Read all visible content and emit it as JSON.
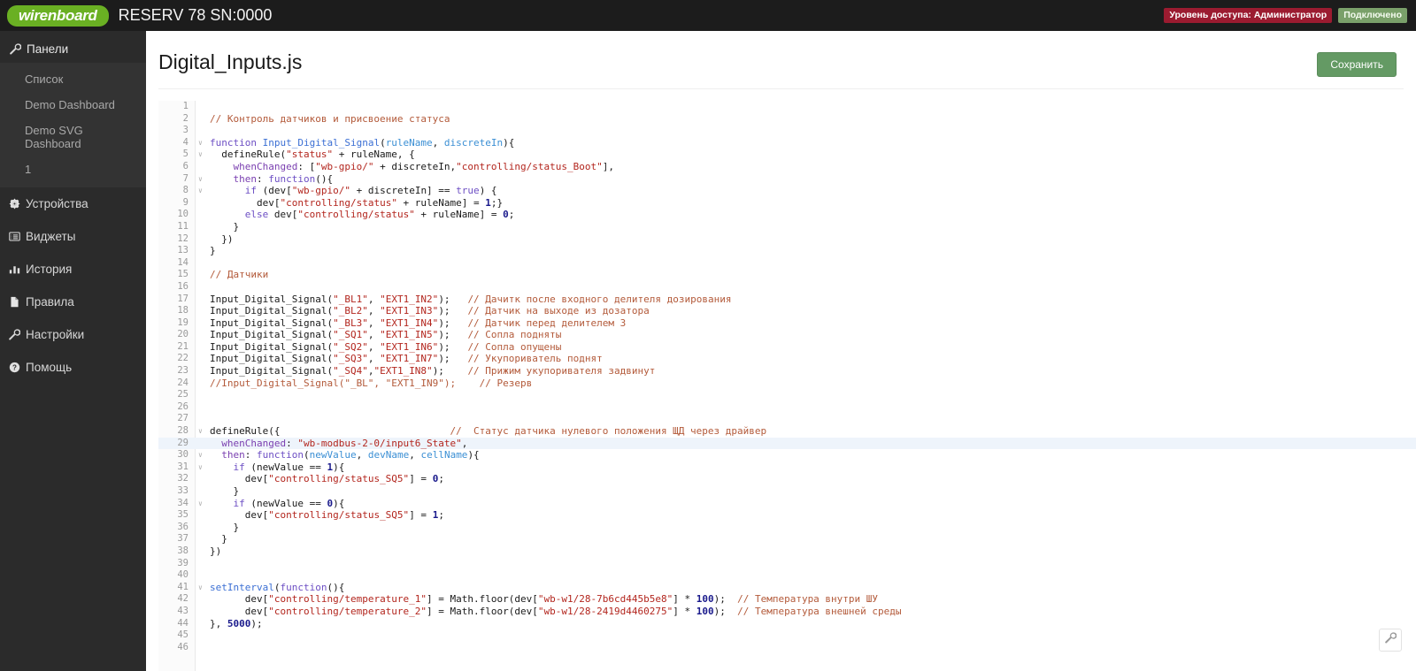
{
  "topbar": {
    "brand": "wirenboard",
    "device_title": "RESERV 78 SN:0000",
    "badge_access": "Уровень доступа: Администратор",
    "badge_connection": "Подключено",
    "brand_color": "#6ab023",
    "access_color": "#9b1b30",
    "connection_color": "#7aa06a"
  },
  "sidebar": {
    "panels_label": "Панели",
    "sub_items": [
      {
        "label": "Список"
      },
      {
        "label": "Demo Dashboard"
      },
      {
        "label": "Demo SVG Dashboard"
      },
      {
        "label": "1"
      }
    ],
    "items": [
      {
        "label": "Устройства",
        "icon": "gear-icon"
      },
      {
        "label": "Виджеты",
        "icon": "list-alt-icon"
      },
      {
        "label": "История",
        "icon": "bar-chart-icon"
      },
      {
        "label": "Правила",
        "icon": "file-icon"
      },
      {
        "label": "Настройки",
        "icon": "wrench-icon"
      },
      {
        "label": "Помощь",
        "icon": "question-circle-icon"
      }
    ]
  },
  "page": {
    "title": "Digital_Inputs.js",
    "save_label": "Сохранить",
    "float_button_icon": "wrench-icon"
  },
  "editor": {
    "active_line": 29,
    "total_lines": 46,
    "lines": [
      {
        "n": 1,
        "fold": false,
        "tokens": []
      },
      {
        "n": 2,
        "fold": false,
        "tokens": [
          {
            "c": "com",
            "t": "// Контроль датчиков и присвоение статуса"
          }
        ]
      },
      {
        "n": 3,
        "fold": false,
        "tokens": []
      },
      {
        "n": 4,
        "fold": true,
        "tokens": [
          {
            "c": "kw",
            "t": "function "
          },
          {
            "c": "fn",
            "t": "Input_Digital_Signal"
          },
          {
            "c": "pln",
            "t": "("
          },
          {
            "c": "var",
            "t": "ruleName"
          },
          {
            "c": "pln",
            "t": ", "
          },
          {
            "c": "var",
            "t": "discreteIn"
          },
          {
            "c": "pln",
            "t": "){"
          }
        ]
      },
      {
        "n": 5,
        "fold": true,
        "tokens": [
          {
            "c": "pln",
            "t": "  defineRule("
          },
          {
            "c": "str",
            "t": "\"status\""
          },
          {
            "c": "pln",
            "t": " + ruleName, {"
          }
        ]
      },
      {
        "n": 6,
        "fold": false,
        "tokens": [
          {
            "c": "prop",
            "t": "    whenChanged"
          },
          {
            "c": "pln",
            "t": ": ["
          },
          {
            "c": "str",
            "t": "\"wb-gpio/\""
          },
          {
            "c": "pln",
            "t": " + discreteIn,"
          },
          {
            "c": "str",
            "t": "\"controlling/status_Boot\""
          },
          {
            "c": "pln",
            "t": "],"
          }
        ]
      },
      {
        "n": 7,
        "fold": true,
        "tokens": [
          {
            "c": "prop",
            "t": "    then"
          },
          {
            "c": "pln",
            "t": ": "
          },
          {
            "c": "kw",
            "t": "function"
          },
          {
            "c": "pln",
            "t": "(){"
          }
        ]
      },
      {
        "n": 8,
        "fold": true,
        "tokens": [
          {
            "c": "kw",
            "t": "      if "
          },
          {
            "c": "pln",
            "t": "(dev["
          },
          {
            "c": "str",
            "t": "\"wb-gpio/\""
          },
          {
            "c": "pln",
            "t": " + discreteIn] == "
          },
          {
            "c": "bool",
            "t": "true"
          },
          {
            "c": "pln",
            "t": ") {"
          }
        ]
      },
      {
        "n": 9,
        "fold": false,
        "tokens": [
          {
            "c": "pln",
            "t": "        dev["
          },
          {
            "c": "str",
            "t": "\"controlling/status\""
          },
          {
            "c": "pln",
            "t": " + ruleName] = "
          },
          {
            "c": "num",
            "t": "1"
          },
          {
            "c": "pln",
            "t": ";}"
          }
        ]
      },
      {
        "n": 10,
        "fold": false,
        "tokens": [
          {
            "c": "kw",
            "t": "      else "
          },
          {
            "c": "pln",
            "t": "dev["
          },
          {
            "c": "str",
            "t": "\"controlling/status\""
          },
          {
            "c": "pln",
            "t": " + ruleName] = "
          },
          {
            "c": "num",
            "t": "0"
          },
          {
            "c": "pln",
            "t": ";"
          }
        ]
      },
      {
        "n": 11,
        "fold": false,
        "tokens": [
          {
            "c": "pln",
            "t": "    }"
          }
        ]
      },
      {
        "n": 12,
        "fold": false,
        "tokens": [
          {
            "c": "pln",
            "t": "  })"
          }
        ]
      },
      {
        "n": 13,
        "fold": false,
        "tokens": [
          {
            "c": "pln",
            "t": "}"
          }
        ]
      },
      {
        "n": 14,
        "fold": false,
        "tokens": []
      },
      {
        "n": 15,
        "fold": false,
        "tokens": [
          {
            "c": "com",
            "t": "// Датчики"
          }
        ]
      },
      {
        "n": 16,
        "fold": false,
        "tokens": []
      },
      {
        "n": 17,
        "fold": false,
        "tokens": [
          {
            "c": "pln",
            "t": "Input_Digital_Signal("
          },
          {
            "c": "str",
            "t": "\"_BL1\""
          },
          {
            "c": "pln",
            "t": ", "
          },
          {
            "c": "str",
            "t": "\"EXT1_IN2\""
          },
          {
            "c": "pln",
            "t": ");   "
          },
          {
            "c": "com",
            "t": "// Дачитк после входного делителя дозирования"
          }
        ]
      },
      {
        "n": 18,
        "fold": false,
        "tokens": [
          {
            "c": "pln",
            "t": "Input_Digital_Signal("
          },
          {
            "c": "str",
            "t": "\"_BL2\""
          },
          {
            "c": "pln",
            "t": ", "
          },
          {
            "c": "str",
            "t": "\"EXT1_IN3\""
          },
          {
            "c": "pln",
            "t": ");   "
          },
          {
            "c": "com",
            "t": "// Датчик на выходе из дозатора"
          }
        ]
      },
      {
        "n": 19,
        "fold": false,
        "tokens": [
          {
            "c": "pln",
            "t": "Input_Digital_Signal("
          },
          {
            "c": "str",
            "t": "\"_BL3\""
          },
          {
            "c": "pln",
            "t": ", "
          },
          {
            "c": "str",
            "t": "\"EXT1_IN4\""
          },
          {
            "c": "pln",
            "t": ");   "
          },
          {
            "c": "com",
            "t": "// Датчик перед делителем 3"
          }
        ]
      },
      {
        "n": 20,
        "fold": false,
        "tokens": [
          {
            "c": "pln",
            "t": "Input_Digital_Signal("
          },
          {
            "c": "str",
            "t": "\"_SQ1\""
          },
          {
            "c": "pln",
            "t": ", "
          },
          {
            "c": "str",
            "t": "\"EXT1_IN5\""
          },
          {
            "c": "pln",
            "t": ");   "
          },
          {
            "c": "com",
            "t": "// Сопла подняты"
          }
        ]
      },
      {
        "n": 21,
        "fold": false,
        "tokens": [
          {
            "c": "pln",
            "t": "Input_Digital_Signal("
          },
          {
            "c": "str",
            "t": "\"_SQ2\""
          },
          {
            "c": "pln",
            "t": ", "
          },
          {
            "c": "str",
            "t": "\"EXT1_IN6\""
          },
          {
            "c": "pln",
            "t": ");   "
          },
          {
            "c": "com",
            "t": "// Сопла опущены"
          }
        ]
      },
      {
        "n": 22,
        "fold": false,
        "tokens": [
          {
            "c": "pln",
            "t": "Input_Digital_Signal("
          },
          {
            "c": "str",
            "t": "\"_SQ3\""
          },
          {
            "c": "pln",
            "t": ", "
          },
          {
            "c": "str",
            "t": "\"EXT1_IN7\""
          },
          {
            "c": "pln",
            "t": ");   "
          },
          {
            "c": "com",
            "t": "// Укупориватель поднят"
          }
        ]
      },
      {
        "n": 23,
        "fold": false,
        "tokens": [
          {
            "c": "pln",
            "t": "Input_Digital_Signal("
          },
          {
            "c": "str",
            "t": "\"_SQ4\""
          },
          {
            "c": "pln",
            "t": ","
          },
          {
            "c": "str",
            "t": "\"EXT1_IN8\""
          },
          {
            "c": "pln",
            "t": ");    "
          },
          {
            "c": "com",
            "t": "// Прижим укупоривателя задвинут"
          }
        ]
      },
      {
        "n": 24,
        "fold": false,
        "tokens": [
          {
            "c": "com",
            "t": "//Input_Digital_Signal(\"_BL\", \"EXT1_IN9\");    // Резерв"
          }
        ]
      },
      {
        "n": 25,
        "fold": false,
        "tokens": []
      },
      {
        "n": 26,
        "fold": false,
        "tokens": []
      },
      {
        "n": 27,
        "fold": false,
        "tokens": []
      },
      {
        "n": 28,
        "fold": true,
        "tokens": [
          {
            "c": "pln",
            "t": "defineRule({                             "
          },
          {
            "c": "com",
            "t": "//  Статус датчика нулевого положения ЩД через драйвер"
          }
        ]
      },
      {
        "n": 29,
        "fold": false,
        "tokens": [
          {
            "c": "prop",
            "t": "  whenChanged"
          },
          {
            "c": "pln",
            "t": ": "
          },
          {
            "c": "str",
            "t": "\"wb-modbus-2-0/input6_State\""
          },
          {
            "c": "pln",
            "t": ","
          }
        ]
      },
      {
        "n": 30,
        "fold": true,
        "tokens": [
          {
            "c": "prop",
            "t": "  then"
          },
          {
            "c": "pln",
            "t": ": "
          },
          {
            "c": "kw",
            "t": "function"
          },
          {
            "c": "pln",
            "t": "("
          },
          {
            "c": "var",
            "t": "newValue"
          },
          {
            "c": "pln",
            "t": ", "
          },
          {
            "c": "var",
            "t": "devName"
          },
          {
            "c": "pln",
            "t": ", "
          },
          {
            "c": "var",
            "t": "cellName"
          },
          {
            "c": "pln",
            "t": "){"
          }
        ]
      },
      {
        "n": 31,
        "fold": true,
        "tokens": [
          {
            "c": "kw",
            "t": "    if "
          },
          {
            "c": "pln",
            "t": "(newValue == "
          },
          {
            "c": "num",
            "t": "1"
          },
          {
            "c": "pln",
            "t": "){"
          }
        ]
      },
      {
        "n": 32,
        "fold": false,
        "tokens": [
          {
            "c": "pln",
            "t": "      dev["
          },
          {
            "c": "str",
            "t": "\"controlling/status_SQ5\""
          },
          {
            "c": "pln",
            "t": "] = "
          },
          {
            "c": "num",
            "t": "0"
          },
          {
            "c": "pln",
            "t": ";"
          }
        ]
      },
      {
        "n": 33,
        "fold": false,
        "tokens": [
          {
            "c": "pln",
            "t": "    }"
          }
        ]
      },
      {
        "n": 34,
        "fold": true,
        "tokens": [
          {
            "c": "kw",
            "t": "    if "
          },
          {
            "c": "pln",
            "t": "(newValue == "
          },
          {
            "c": "num",
            "t": "0"
          },
          {
            "c": "pln",
            "t": "){"
          }
        ]
      },
      {
        "n": 35,
        "fold": false,
        "tokens": [
          {
            "c": "pln",
            "t": "      dev["
          },
          {
            "c": "str",
            "t": "\"controlling/status_SQ5\""
          },
          {
            "c": "pln",
            "t": "] = "
          },
          {
            "c": "num",
            "t": "1"
          },
          {
            "c": "pln",
            "t": ";"
          }
        ]
      },
      {
        "n": 36,
        "fold": false,
        "tokens": [
          {
            "c": "pln",
            "t": "    }"
          }
        ]
      },
      {
        "n": 37,
        "fold": false,
        "tokens": [
          {
            "c": "pln",
            "t": "  }"
          }
        ]
      },
      {
        "n": 38,
        "fold": false,
        "tokens": [
          {
            "c": "pln",
            "t": "})"
          }
        ]
      },
      {
        "n": 39,
        "fold": false,
        "tokens": []
      },
      {
        "n": 40,
        "fold": false,
        "tokens": []
      },
      {
        "n": 41,
        "fold": true,
        "tokens": [
          {
            "c": "fn",
            "t": "setInterval"
          },
          {
            "c": "pln",
            "t": "("
          },
          {
            "c": "kw",
            "t": "function"
          },
          {
            "c": "pln",
            "t": "(){"
          }
        ]
      },
      {
        "n": 42,
        "fold": false,
        "tokens": [
          {
            "c": "pln",
            "t": "      dev["
          },
          {
            "c": "str",
            "t": "\"controlling/temperature_1\""
          },
          {
            "c": "pln",
            "t": "] = Math.floor(dev["
          },
          {
            "c": "str",
            "t": "\"wb-w1/28-7b6cd445b5e8\""
          },
          {
            "c": "pln",
            "t": "] * "
          },
          {
            "c": "num",
            "t": "100"
          },
          {
            "c": "pln",
            "t": ");  "
          },
          {
            "c": "com",
            "t": "// Температура внутри ШУ"
          }
        ]
      },
      {
        "n": 43,
        "fold": false,
        "tokens": [
          {
            "c": "pln",
            "t": "      dev["
          },
          {
            "c": "str",
            "t": "\"controlling/temperature_2\""
          },
          {
            "c": "pln",
            "t": "] = Math.floor(dev["
          },
          {
            "c": "str",
            "t": "\"wb-w1/28-2419d4460275\""
          },
          {
            "c": "pln",
            "t": "] * "
          },
          {
            "c": "num",
            "t": "100"
          },
          {
            "c": "pln",
            "t": ");  "
          },
          {
            "c": "com",
            "t": "// Температура внешней среды"
          }
        ]
      },
      {
        "n": 44,
        "fold": false,
        "tokens": [
          {
            "c": "pln",
            "t": "}, "
          },
          {
            "c": "num",
            "t": "5000"
          },
          {
            "c": "pln",
            "t": ");"
          }
        ]
      },
      {
        "n": 45,
        "fold": false,
        "tokens": []
      },
      {
        "n": 46,
        "fold": false,
        "tokens": []
      }
    ]
  }
}
